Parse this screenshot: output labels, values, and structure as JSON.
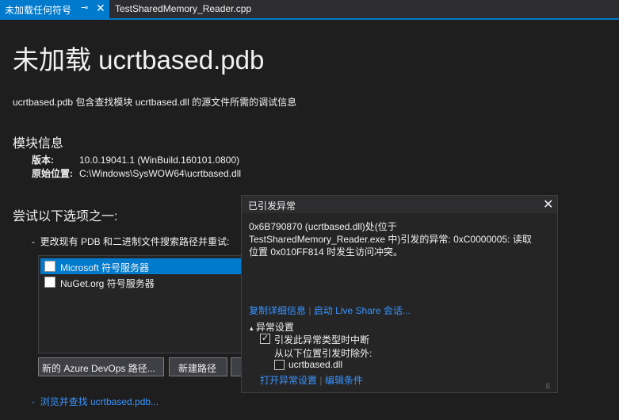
{
  "tabs": [
    {
      "label": "未加载任何符号",
      "pin": "⊸",
      "close": "✕"
    },
    {
      "label": "TestSharedMemory_Reader.cpp"
    }
  ],
  "page": {
    "title": "未加载 ucrtbased.pdb",
    "description": "ucrtbased.pdb 包含查找模块 ucrtbased.dll 的源文件所需的调试信息",
    "module_heading": "模块信息",
    "version_label": "版本:",
    "version_value": "10.0.19041.1 (WinBuild.160101.0800)",
    "origin_label": "原始位置:",
    "origin_value": "C:\\Windows\\SysWOW64\\ucrtbased.dll",
    "options_heading": "尝试以下选项之一:",
    "option1": "更改现有 PDB 和二进制文件搜索路径并重试:",
    "list": [
      {
        "label": "Microsoft 符号服务器"
      },
      {
        "label": "NuGet.org 符号服务器"
      }
    ],
    "btn_azure": "新的 Azure DevOps 路径...",
    "btn_new_path": "新建路径",
    "bullet_dash": "-",
    "browse_link": "浏览并查找 ucrtbased.pdb..."
  },
  "popup": {
    "title": "已引发异常",
    "close": "✕",
    "message_lines": [
      "0x6B790870 (ucrtbased.dll)处(位于",
      "TestSharedMemory_Reader.exe 中)引发的异常: 0xC0000005: 读取",
      "位置 0x010FF814 时发生访问冲突。"
    ],
    "copy_details": "复制详细信息",
    "separator": "|",
    "live_share": "启动 Live Share 会话...",
    "settings_toggle": "▴",
    "settings_heading": "异常设置",
    "break_label": "引发此异常类型时中断",
    "break_checked": true,
    "except_label": "从以下位置引发时除外:",
    "module_label": "ucrtbased.dll",
    "module_checked": false,
    "open_settings": "打开异常设置",
    "edit_conditions": "编辑条件",
    "grip": "⠿"
  },
  "colors": {
    "accent": "#007acc",
    "link": "#3794ff",
    "background": "#1e1e1e"
  }
}
